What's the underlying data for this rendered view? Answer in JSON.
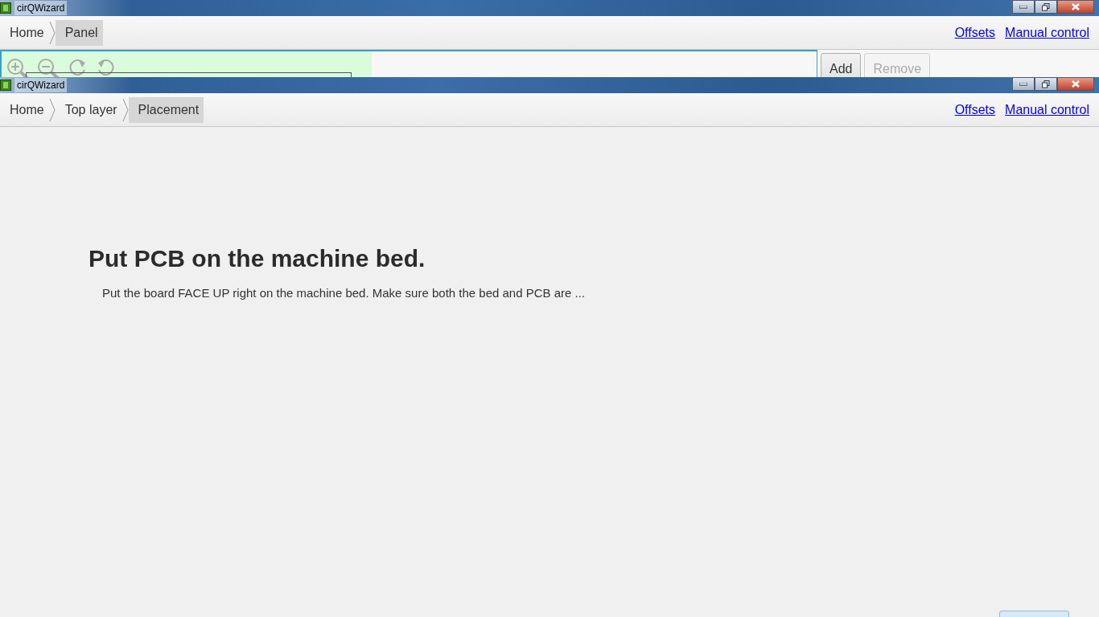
{
  "windows": [
    {
      "title": "cirQWizard",
      "breadcrumb": [
        {
          "label": "Home",
          "selected": false
        },
        {
          "label": "Panel",
          "selected": true
        }
      ],
      "links": [
        "Offsets",
        "Manual control"
      ],
      "buttons": [
        {
          "label": "Add",
          "disabled": false
        },
        {
          "label": "Remove",
          "disabled": true
        }
      ]
    },
    {
      "title": "cirQWizard",
      "breadcrumb": [
        {
          "label": "Home",
          "selected": false
        },
        {
          "label": "Top layer",
          "selected": false
        },
        {
          "label": "Placement",
          "selected": true
        }
      ],
      "links": [
        "Offsets",
        "Manual control"
      ],
      "heading": "Put PCB on the machine bed.",
      "text": "Put the board FACE UP right on the machine bed. Make sure both the bed and PCB are ..."
    }
  ]
}
